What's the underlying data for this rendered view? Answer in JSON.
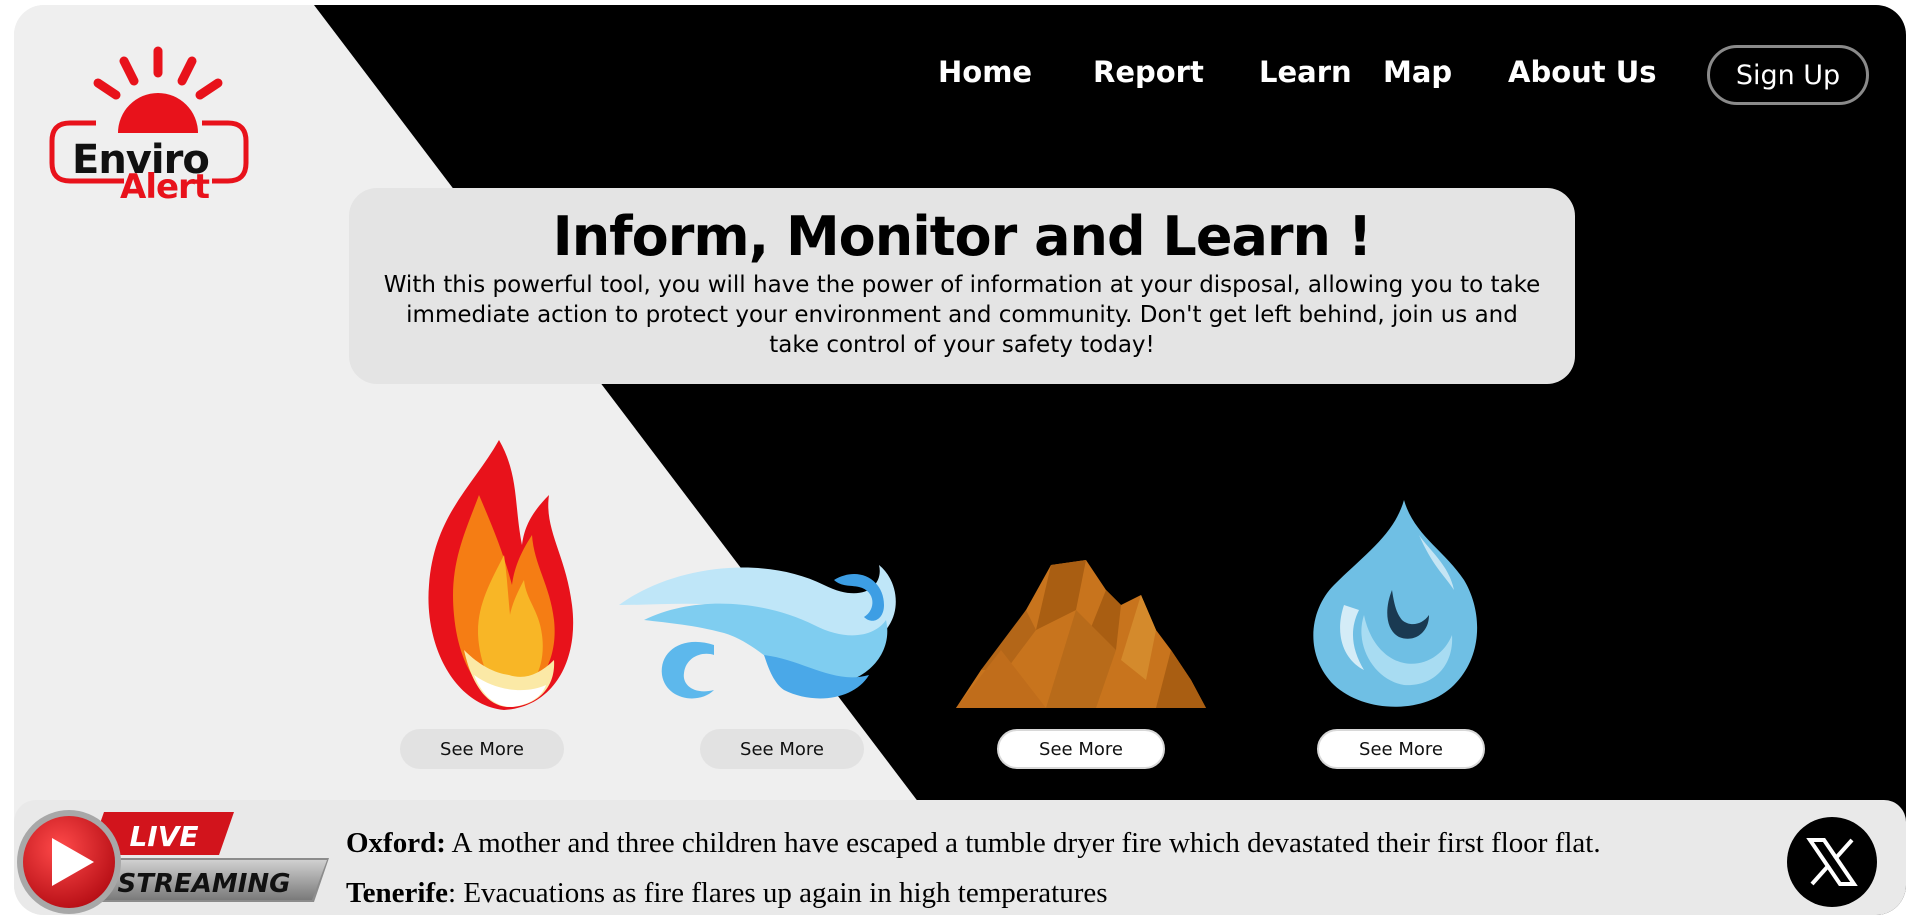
{
  "brand": {
    "logo_word1": "Enviro",
    "logo_word2": "Alert",
    "accent_red": "#e8121b"
  },
  "nav": {
    "items": [
      {
        "label": "Home"
      },
      {
        "label": "Report"
      },
      {
        "label": "Learn"
      },
      {
        "label": "Map"
      },
      {
        "label": "About Us"
      }
    ],
    "signup_label": "Sign Up"
  },
  "hero": {
    "title": "Inform, Monitor and Learn !",
    "description_lines": [
      "With this powerful tool, you will have the power of information at your disposal, allowing you to take",
      "immediate action to protect your environment and community. Don't get left behind, join us and",
      "take control of your safety today!"
    ]
  },
  "elements": [
    {
      "icon": "fire-icon",
      "button": "See More"
    },
    {
      "icon": "wind-icon",
      "button": "See More"
    },
    {
      "icon": "earth-icon",
      "button": "See More"
    },
    {
      "icon": "water-icon",
      "button": "See More"
    }
  ],
  "ticker": {
    "badge_live": "LIVE",
    "badge_streaming": "STREAMING",
    "news": [
      {
        "place": "Oxford:",
        "text": " A mother and three children have escaped a tumble dryer fire which devastated their first floor flat."
      },
      {
        "place": "Tenerife",
        "text": ": Evacuations as fire flares up again in high temperatures"
      }
    ]
  },
  "colors": {
    "dark_bg": "#000000",
    "light_bg": "#efefef",
    "hero_bg": "#e4e4e4"
  }
}
